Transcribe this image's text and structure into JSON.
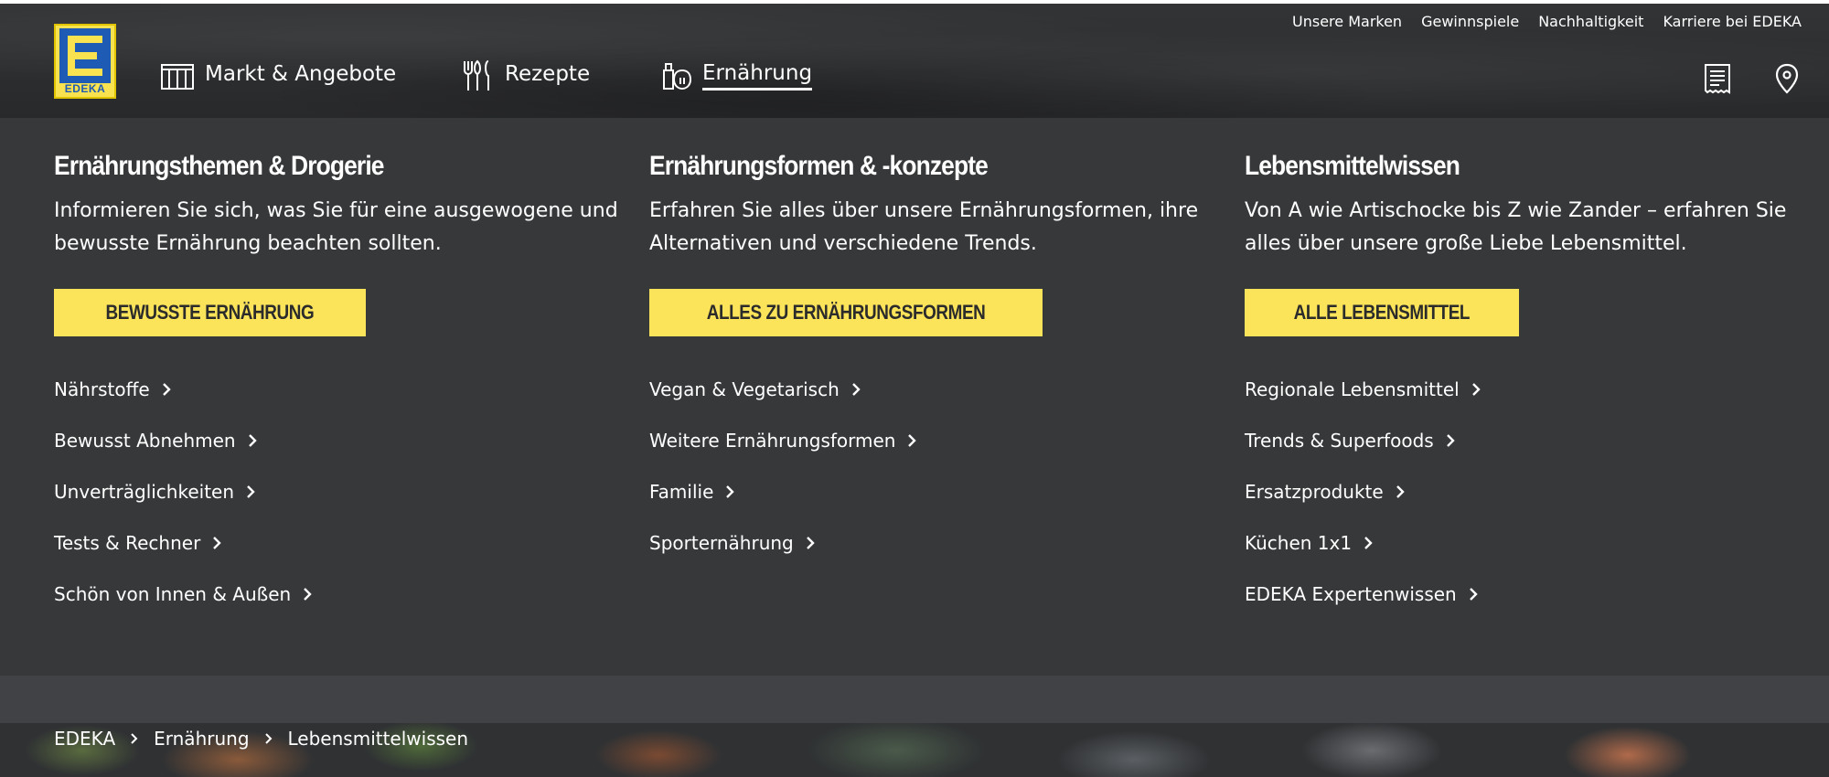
{
  "header": {
    "logo_text": "EDEKA",
    "main_nav": [
      {
        "label": "Markt & Angebote",
        "icon": "market-icon",
        "active": false
      },
      {
        "label": "Rezepte",
        "icon": "cutlery-icon",
        "active": false
      },
      {
        "label": "Ernährung",
        "icon": "nutrition-icon",
        "active": true
      }
    ],
    "top_nav": [
      "Unsere Marken",
      "Gewinnspiele",
      "Nachhaltigkeit",
      "Karriere bei EDEKA"
    ],
    "icons": [
      "receipt-icon",
      "location-pin-icon"
    ]
  },
  "mega_menu": {
    "columns": [
      {
        "title": "Ernährungsthemen & Drogerie",
        "description": "Informieren Sie sich, was Sie für eine ausgewogene und bewusste Ernährung beachten sollten.",
        "cta": "BEWUSSTE ERNÄHRUNG",
        "links": [
          "Nährstoffe",
          "Bewusst Abnehmen",
          "Unverträglichkeiten",
          "Tests & Rechner",
          "Schön von Innen & Außen"
        ]
      },
      {
        "title": "Ernährungsformen & -konzepte",
        "description": "Erfahren Sie alles über unsere Ernährungsformen, ihre Alternativen und verschiedene Trends.",
        "cta": "ALLES ZU ERNÄHRUNGSFORMEN",
        "links": [
          "Vegan & Vegetarisch",
          "Weitere Ernährungsformen",
          "Familie",
          "Sporternährung"
        ]
      },
      {
        "title": "Lebensmittelwissen",
        "description": "Von A wie Artischocke bis Z wie Zander – erfahren Sie alles über unsere große Liebe Lebensmittel.",
        "cta": "ALLE LEBENSMITTEL",
        "links": [
          "Regionale Lebensmittel",
          "Trends & Superfoods",
          "Ersatzprodukte",
          "Küchen 1x1",
          "EDEKA Expertenwissen"
        ]
      }
    ]
  },
  "breadcrumb": [
    "EDEKA",
    "Ernährung",
    "Lebensmittelwissen"
  ],
  "colors": {
    "header_bg": "#2c2e30",
    "menu_bg": "#36383a",
    "cta_bg": "#fbe35a",
    "logo_yellow": "#f9e24f",
    "logo_blue": "#1d5bb4"
  }
}
